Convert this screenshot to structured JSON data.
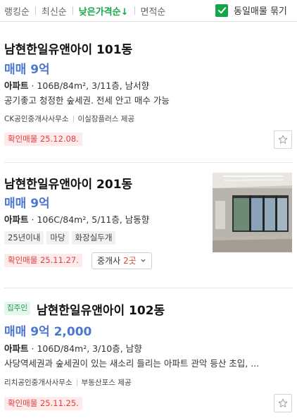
{
  "sort_bar": {
    "options": [
      "랭킹순",
      "최신순",
      "낮은가격순",
      "면적순"
    ],
    "active_arrow": "↓",
    "group_toggle_label": "동일매물 묶기",
    "group_checked": true
  },
  "listings": [
    {
      "title": "남현한일유앤아이 101동",
      "price": "매매 9억",
      "type": "아파트",
      "spec": "106B/84m², 3/11층, 남서향",
      "description": "공기좋고 청정한 숲세권. 전세 안고 매수 가능",
      "agency": "CK공인중개사사무소",
      "provider": "이실장플러스 제공",
      "verified": "확인매물 25.12.08."
    },
    {
      "title": "남현한일유앤아이 201동",
      "price": "매매 9억",
      "type": "아파트",
      "spec": "106C/84m², 5/11층, 남동향",
      "tags": [
        "25년이내",
        "마당",
        "화장실두개"
      ],
      "verified": "확인매물 25.11.27.",
      "agent_label": "중개사",
      "agent_count": "2곳",
      "has_photo": true
    },
    {
      "owner_badge": "집주인",
      "title": "남현한일유앤아이 102동",
      "price": "매매 9억 2,000",
      "type": "아파트",
      "spec": "106D/84m², 3/10층, 남향",
      "description": "사당역세권과 숲세권이 있는 새소리 들리는 아파트 관악 등산 초입, ...",
      "agency": "리치공인중개사사무소",
      "provider": "부동산포스 제공",
      "verified": "확인매물 25.11.25."
    }
  ],
  "colors": {
    "accent_green": "#17a64a",
    "price_blue": "#4d77cf",
    "badge_red": "#e04040"
  }
}
